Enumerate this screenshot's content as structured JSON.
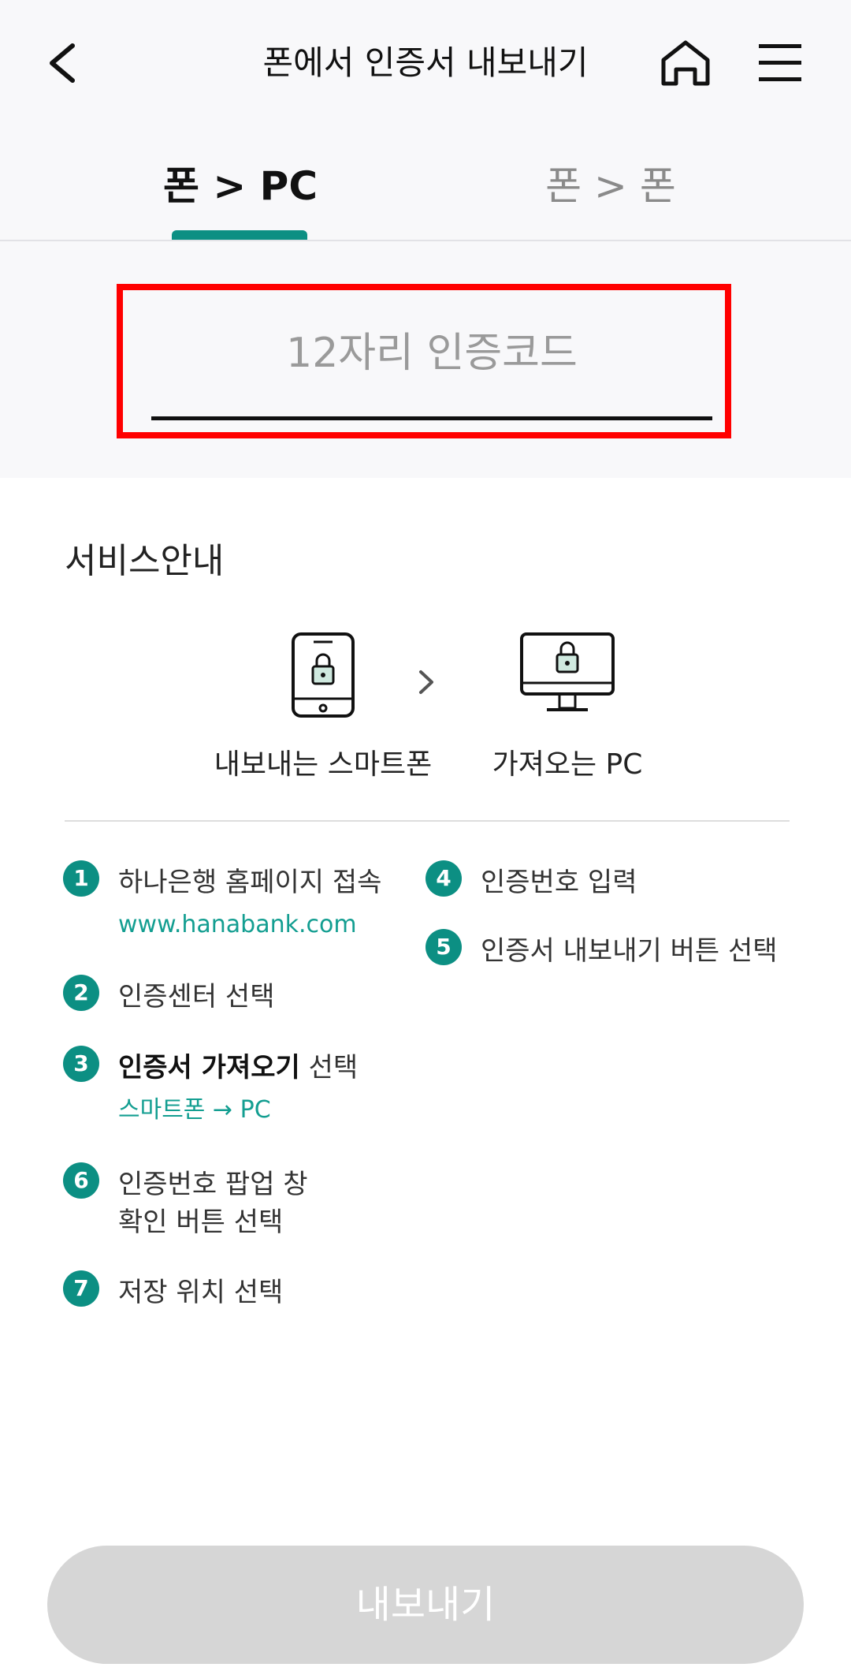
{
  "header": {
    "title": "폰에서 인증서 내보내기",
    "back_icon": "chevron-left-icon",
    "home_icon": "home-icon",
    "menu_icon": "hamburger-menu-icon"
  },
  "tabs": [
    {
      "label": "폰 > PC",
      "selected": true
    },
    {
      "label": "폰 > 폰",
      "selected": false
    }
  ],
  "code_input": {
    "placeholder": "12자리 인증코드",
    "value": ""
  },
  "service_guide": {
    "title": "서비스안내",
    "from_device_label": "내보내는 스마트폰",
    "to_device_label": "가져오는 PC"
  },
  "steps_left": [
    {
      "num": "1",
      "text": "하나은행 홈페이지 접속",
      "sub": "www.hanabank.com"
    },
    {
      "num": "2",
      "text": "인증센터 선택"
    },
    {
      "num": "3",
      "bold": "인증서 가져오기",
      "text": " 선택",
      "sub": "스마트폰  →  PC"
    },
    {
      "num": "6",
      "text": "인증번호 팝업 창",
      "text2": "확인 버튼 선택"
    },
    {
      "num": "7",
      "text": "저장 위치 선택"
    }
  ],
  "steps_right": [
    {
      "num": "4",
      "text": "인증번호 입력"
    },
    {
      "num": "5",
      "text": "인증서 내보내기 버튼 선택"
    }
  ],
  "export_button": {
    "label": "내보내기"
  },
  "colors": {
    "accent": "#0c8f83",
    "highlight_border": "#ff0000",
    "button_disabled": "#d6d6d6"
  }
}
